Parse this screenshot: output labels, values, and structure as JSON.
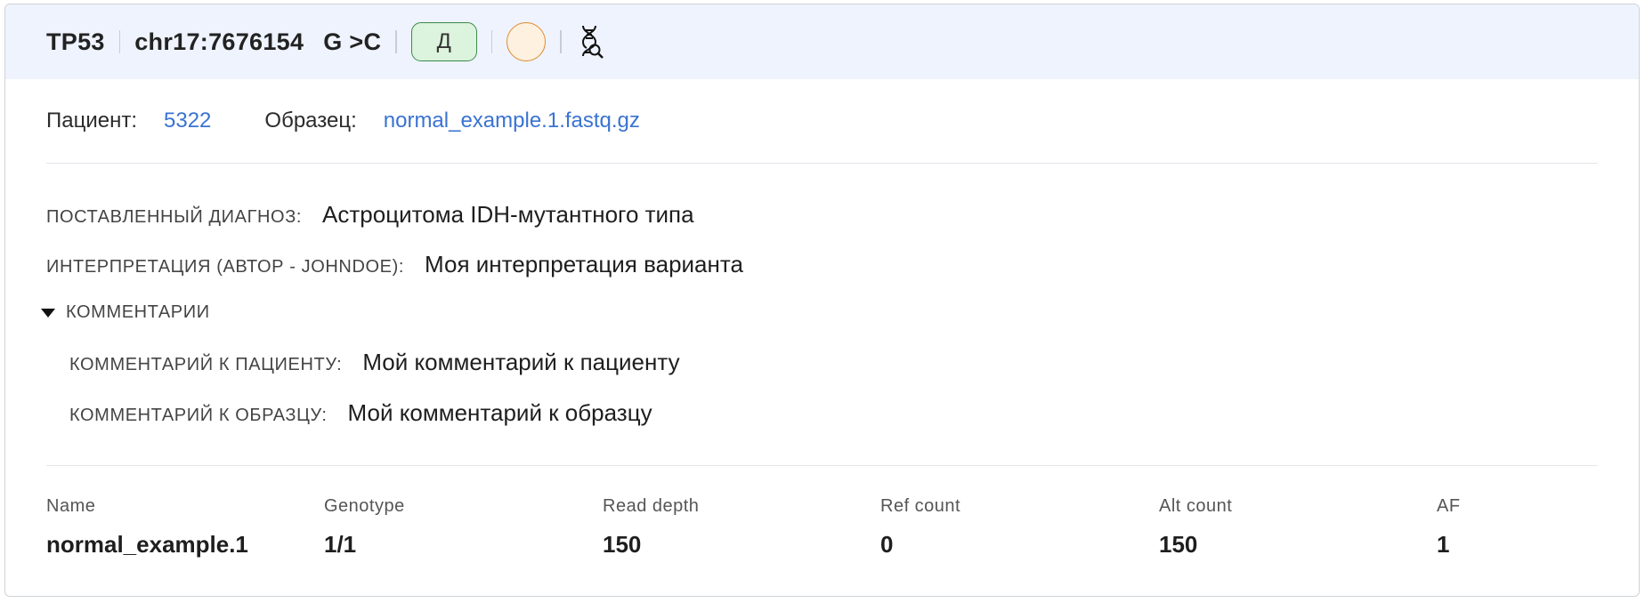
{
  "header": {
    "gene": "TP53",
    "position": "chr17:7676154",
    "change": "G >C",
    "badge_label": "Д",
    "colors": {
      "badge_bg": "#dcf3dd",
      "badge_border": "#3b8a4a",
      "circle_bg": "#fff1df",
      "circle_border": "#e08a2c"
    },
    "icon": "dna-search-icon"
  },
  "meta": {
    "patient_label": "Пациент:",
    "patient_value": "5322",
    "sample_label": "Образец:",
    "sample_value": "normal_example.1.fastq.gz"
  },
  "details": {
    "diagnosis_label": "ПОСТАВЛЕННЫЙ ДИАГНОЗ:",
    "diagnosis_value": "Астроцитома IDH-мутантного типа",
    "interpretation_label": "ИНТЕРПРЕТАЦИЯ (АВТОР - JOHNDOE):",
    "interpretation_value": "Моя интерпретация варианта",
    "comments_toggle": "КОММЕНТАРИИ",
    "patient_comment_label": "КОММЕНТАРИЙ К ПАЦИЕНТУ:",
    "patient_comment_value": "Мой комментарий к пациенту",
    "sample_comment_label": "КОММЕНТАРИЙ К ОБРАЗЦУ:",
    "sample_comment_value": "Мой комментарий к образцу"
  },
  "table": {
    "columns": [
      "Name",
      "Genotype",
      "Read depth",
      "Ref count",
      "Alt count",
      "AF"
    ],
    "row": [
      "normal_example.1",
      "1/1",
      "150",
      "0",
      "150",
      "1"
    ]
  }
}
